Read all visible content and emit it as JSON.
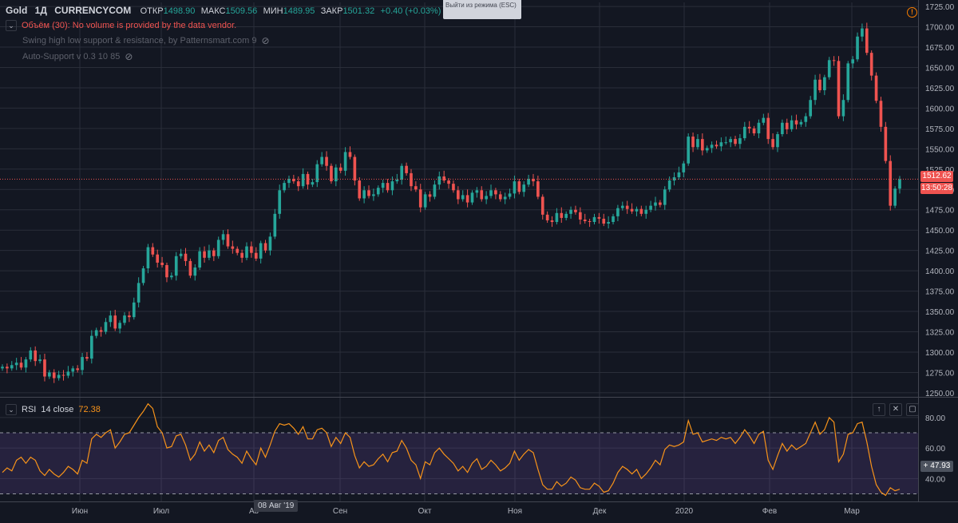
{
  "header": {
    "symbol": "Gold",
    "interval": "1Д",
    "exchange": "CURRENCYCOM",
    "open_label": "ОТКР",
    "open_value": "1498.90",
    "high_label": "МАКС",
    "high_value": "1509.56",
    "low_label": "МИН",
    "low_value": "1489.95",
    "close_label": "ЗАКР",
    "close_value": "1501.32",
    "change": "+0.40 (+0.03%)"
  },
  "indicators": {
    "volume_text": "Объём (30): No volume is provided by the data vendor.",
    "swing_text": "Swing high low support & resistance, by Patternsmart.com 9",
    "autosupport_text": "Auto-Support v 0.3 10 85"
  },
  "esc_tooltip": "Выйти из режима (ESC)",
  "price_axis": {
    "ticks": [
      "1725.00",
      "1700.00",
      "1675.00",
      "1650.00",
      "1625.00",
      "1600.00",
      "1575.00",
      "1550.00",
      "1525.00",
      "1500.00",
      "1475.00",
      "1450.00",
      "1425.00",
      "1400.00",
      "1375.00",
      "1350.00",
      "1325.00",
      "1300.00",
      "1275.00",
      "1250.00"
    ],
    "last_price": "1512.62",
    "countdown": "13:50:28"
  },
  "rsi": {
    "name": "RSI",
    "params": "14 close",
    "value": "72.38",
    "axis_ticks": [
      "80.00",
      "60.00",
      "40.00"
    ],
    "cursor_value": "47.93"
  },
  "time_axis": {
    "labels": [
      "Июн",
      "Июл",
      "Ав",
      "Сен",
      "Окт",
      "Ноя",
      "Дек",
      "2020",
      "Фев",
      "Мар"
    ],
    "crosshair_date": "08 Авг '19"
  },
  "colors": {
    "background": "#131722",
    "up": "#26a69a",
    "down": "#ef5350",
    "rsi_line": "#f7931a",
    "rsi_band": "#7e57c2",
    "grid": "#2a2e39"
  },
  "chart_data": {
    "type": "candlestick",
    "title": "Gold 1Д CURRENCYCOM",
    "ylim": [
      1245,
      1730
    ],
    "y_ticks": [
      1725,
      1700,
      1675,
      1650,
      1625,
      1600,
      1575,
      1550,
      1525,
      1500,
      1475,
      1450,
      1425,
      1400,
      1375,
      1350,
      1325,
      1300,
      1275,
      1250
    ],
    "last_price": 1512.62,
    "close_series": [
      1282,
      1280,
      1284,
      1287,
      1281,
      1291,
      1302,
      1289,
      1291,
      1270,
      1275,
      1268,
      1272,
      1271,
      1276,
      1280,
      1278,
      1294,
      1292,
      1320,
      1327,
      1325,
      1337,
      1345,
      1329,
      1336,
      1345,
      1343,
      1361,
      1385,
      1403,
      1429,
      1420,
      1410,
      1407,
      1392,
      1394,
      1418,
      1421,
      1412,
      1394,
      1404,
      1424,
      1416,
      1425,
      1418,
      1438,
      1445,
      1430,
      1427,
      1422,
      1416,
      1430,
      1422,
      1415,
      1434,
      1425,
      1442,
      1470,
      1499,
      1508,
      1513,
      1510,
      1504,
      1519,
      1506,
      1509,
      1531,
      1540,
      1529,
      1510,
      1527,
      1523,
      1546,
      1540,
      1511,
      1489,
      1499,
      1492,
      1494,
      1502,
      1508,
      1499,
      1510,
      1512,
      1529,
      1520,
      1504,
      1500,
      1478,
      1494,
      1491,
      1506,
      1516,
      1511,
      1507,
      1499,
      1488,
      1493,
      1484,
      1496,
      1499,
      1488,
      1492,
      1499,
      1494,
      1488,
      1491,
      1495,
      1510,
      1497,
      1506,
      1513,
      1510,
      1491,
      1469,
      1462,
      1460,
      1471,
      1465,
      1470,
      1475,
      1472,
      1463,
      1461,
      1460,
      1466,
      1464,
      1458,
      1460,
      1467,
      1477,
      1480,
      1476,
      1473,
      1476,
      1470,
      1475,
      1480,
      1484,
      1481,
      1500,
      1511,
      1515,
      1521,
      1532,
      1565,
      1552,
      1562,
      1548,
      1551,
      1555,
      1553,
      1558,
      1558,
      1562,
      1556,
      1563,
      1577,
      1575,
      1569,
      1582,
      1588,
      1562,
      1552,
      1568,
      1582,
      1574,
      1585,
      1580,
      1583,
      1590,
      1610,
      1635,
      1622,
      1638,
      1659,
      1658,
      1590,
      1610,
      1655,
      1660,
      1688,
      1698,
      1668,
      1640,
      1609,
      1577,
      1535,
      1480,
      1501,
      1512.62
    ],
    "rsi_series": [
      44,
      47,
      45,
      52,
      54,
      50,
      54,
      52,
      45,
      42,
      46,
      43,
      41,
      44,
      48,
      46,
      43,
      52,
      50,
      66,
      69,
      67,
      70,
      72,
      60,
      64,
      69,
      70,
      75,
      80,
      84,
      89,
      86,
      74,
      70,
      60,
      61,
      68,
      69,
      62,
      52,
      56,
      64,
      58,
      62,
      57,
      65,
      67,
      59,
      56,
      54,
      50,
      58,
      53,
      49,
      60,
      54,
      62,
      71,
      76,
      75,
      76,
      73,
      69,
      74,
      66,
      66,
      72,
      73,
      70,
      61,
      67,
      63,
      70,
      67,
      55,
      47,
      51,
      48,
      49,
      53,
      56,
      51,
      57,
      58,
      65,
      60,
      52,
      49,
      40,
      51,
      49,
      57,
      60,
      56,
      53,
      50,
      45,
      48,
      44,
      50,
      53,
      46,
      48,
      52,
      49,
      45,
      47,
      50,
      58,
      52,
      56,
      59,
      57,
      46,
      36,
      33,
      33,
      38,
      35,
      37,
      41,
      39,
      34,
      33,
      33,
      37,
      35,
      31,
      32,
      37,
      44,
      48,
      46,
      43,
      46,
      40,
      43,
      47,
      52,
      49,
      59,
      62,
      61,
      62,
      64,
      78,
      69,
      70,
      64,
      65,
      66,
      65,
      67,
      66,
      67,
      63,
      67,
      72,
      68,
      63,
      69,
      71,
      52,
      46,
      55,
      63,
      58,
      62,
      59,
      61,
      63,
      70,
      77,
      69,
      72,
      80,
      77,
      51,
      56,
      69,
      70,
      76,
      77,
      64,
      48,
      36,
      31,
      29,
      34,
      32,
      33
    ],
    "rsi_levels": {
      "upper": 70,
      "lower": 30,
      "ylim": [
        25,
        92
      ]
    }
  }
}
